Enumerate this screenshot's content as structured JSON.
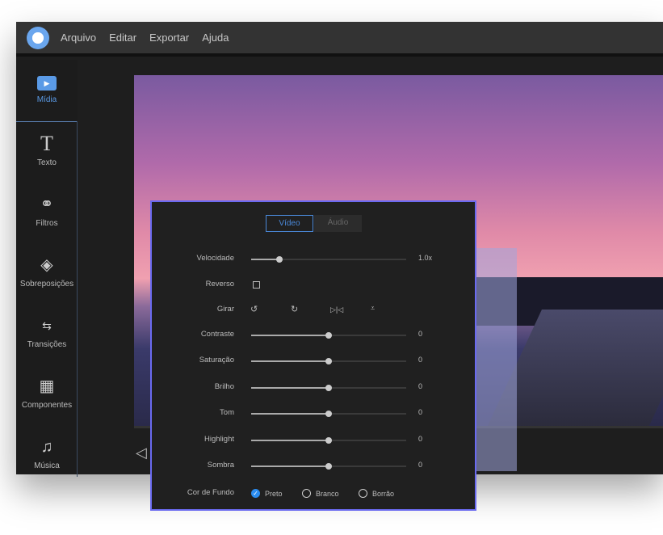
{
  "menu": [
    "Arquivo",
    "Editar",
    "Exportar",
    "Ajuda"
  ],
  "sidebar": [
    {
      "label": "Mídia",
      "icon": "media-icon",
      "active": true
    },
    {
      "label": "Texto",
      "icon": "text-icon"
    },
    {
      "label": "Filtros",
      "icon": "filters-icon"
    },
    {
      "label": "Sobreposições",
      "icon": "overlays-icon"
    },
    {
      "label": "Transições",
      "icon": "transitions-icon"
    },
    {
      "label": "Componentes",
      "icon": "components-icon"
    },
    {
      "label": "Música",
      "icon": "music-icon"
    }
  ],
  "dialog": {
    "tabs": [
      "Vídeo",
      "Áudio"
    ],
    "speed": {
      "label": "Velocidade",
      "value": "1.0x",
      "level": 0.18
    },
    "reverse": {
      "label": "Reverso",
      "checked": false
    },
    "rotate": {
      "label": "Girar"
    },
    "sliders": [
      {
        "label": "Contraste",
        "value": "0",
        "level": 0.5
      },
      {
        "label": "Saturação",
        "value": "0",
        "level": 0.5
      },
      {
        "label": "Brilho",
        "value": "0",
        "level": 0.5
      },
      {
        "label": "Tom",
        "value": "0",
        "level": 0.5
      },
      {
        "label": "Highlight",
        "value": "0",
        "level": 0.5
      },
      {
        "label": "Sombra",
        "value": "0",
        "level": 0.5
      }
    ],
    "background": {
      "label": "Cor de Fundo",
      "options": [
        "Preto",
        "Branco",
        "Borrão"
      ],
      "selected": "Preto"
    }
  },
  "colors": {
    "accent": "#4a88d8",
    "dialog_border": "#6a6af0"
  }
}
